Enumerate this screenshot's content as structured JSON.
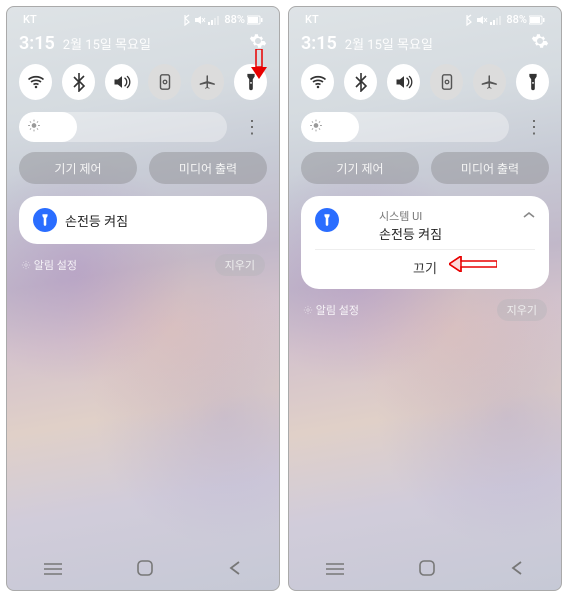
{
  "status": {
    "carrier": "KT",
    "battery": "88%"
  },
  "time": "3:15",
  "date": "2월 15일 목요일",
  "brightness_percent": 28,
  "pills": {
    "device_control": "기기 제어",
    "media_output": "미디어 출력"
  },
  "notification_collapsed": {
    "title": "손전등 켜짐"
  },
  "notification_expanded": {
    "app": "시스템 UI",
    "title": "손전등 켜짐",
    "action": "끄기"
  },
  "footer": {
    "settings": "알림 설정",
    "clear": "지우기"
  }
}
